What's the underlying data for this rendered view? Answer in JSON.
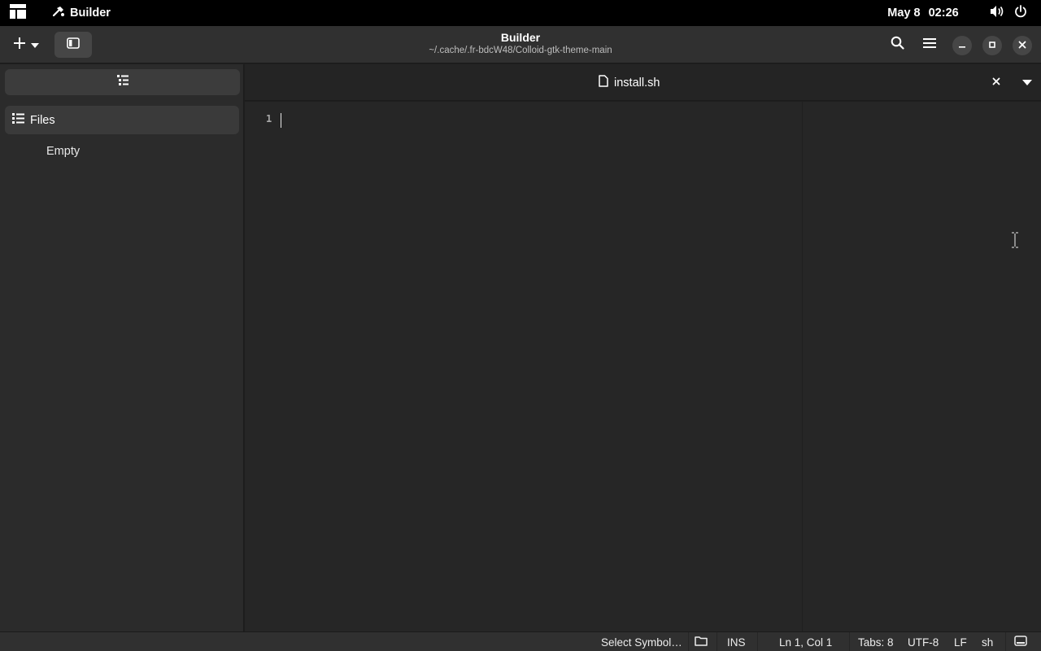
{
  "topbar": {
    "activities_icon": "activities-grid-icon",
    "app_name": "Builder",
    "app_icon": "builder-hammer-icon",
    "clock_date": "May 8",
    "clock_time": "02:26",
    "volume_icon": "speaker-icon",
    "power_icon": "power-icon"
  },
  "header": {
    "title": "Builder",
    "subtitle": "~/.cache/.fr-bdcW48/Colloid-gtk-theme-main",
    "new_icon": "plus-icon",
    "new_dropdown_icon": "chevron-down-icon",
    "sidebar_toggle_icon": "sidebar-panel-icon",
    "search_icon": "search-icon",
    "menu_icon": "hamburger-menu-icon",
    "minimize_icon": "minimize-icon",
    "maximize_icon": "maximize-icon",
    "close_icon": "close-icon"
  },
  "sidebar": {
    "header_icon": "list-view-icon",
    "section_label": "Files",
    "section_icon": "file-list-icon",
    "empty_text": "Empty"
  },
  "editor": {
    "tab_title": "install.sh",
    "tab_icon": "document-icon",
    "line_numbers": [
      "1"
    ],
    "content": ""
  },
  "statusbar": {
    "symbol_selector": "Select Symbol…",
    "folder_icon": "folder-icon",
    "mode": "INS",
    "position": "Ln 1, Col 1",
    "tabs": "Tabs: 8",
    "encoding": "UTF-8",
    "line_ending": "LF",
    "language": "sh",
    "panel_icon": "bottom-panel-icon"
  },
  "colors": {
    "topbar_bg": "#000000",
    "headerbar_bg": "#303030",
    "sidebar_bg": "#2b2b2b",
    "editor_bg": "#262626",
    "text": "#ffffff"
  }
}
